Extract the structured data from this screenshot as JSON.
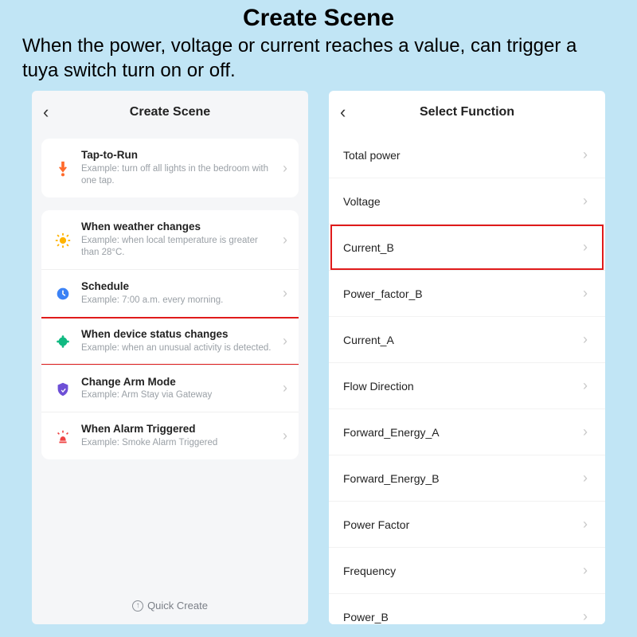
{
  "page": {
    "title": "Create Scene",
    "subtitle": "When the power, voltage or current reaches a value, can trigger a tuya switch turn on or off."
  },
  "left": {
    "header_title": "Create Scene",
    "quick_create": "Quick Create",
    "tap_to_run": {
      "title": "Tap-to-Run",
      "desc": "Example: turn off all lights in the bedroom with one tap."
    },
    "weather": {
      "title": "When weather changes",
      "desc": "Example: when local temperature is greater than 28°C."
    },
    "schedule": {
      "title": "Schedule",
      "desc": "Example: 7:00 a.m. every morning."
    },
    "device_status": {
      "title": "When device status changes",
      "desc": "Example: when an unusual activity is detected."
    },
    "arm_mode": {
      "title": "Change Arm Mode",
      "desc": "Example: Arm Stay via Gateway"
    },
    "alarm": {
      "title": "When Alarm Triggered",
      "desc": "Example: Smoke Alarm Triggered"
    }
  },
  "right": {
    "header_title": "Select Function",
    "items": [
      "Total power",
      "Voltage",
      "Current_B",
      "Power_factor_B",
      "Current_A",
      "Flow Direction",
      "Forward_Energy_A",
      "Forward_Energy_B",
      "Power Factor",
      "Frequency",
      "Power_B"
    ],
    "highlight_index": 2
  }
}
